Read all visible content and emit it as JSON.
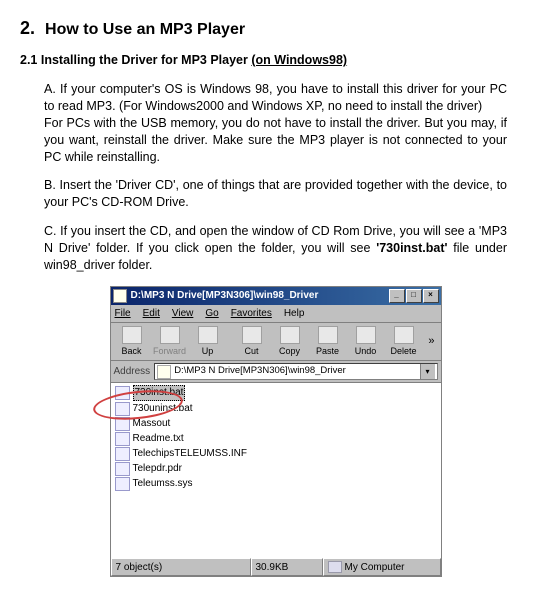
{
  "heading": {
    "num": "2.",
    "title": "How to Use an MP3 Player"
  },
  "subheading": {
    "text": "2.1 Installing the Driver for MP3 Player ",
    "paren": "(on Windows98)"
  },
  "paragraphs": {
    "a1": "A.  If your computer's OS is Windows 98, you have to install this driver for your PC to read MP3. (For Windows2000 and Windows XP, no need to install the driver)",
    "a2": "For PCs with the USB memory, you do not have to install the driver. But you may, if you want, reinstall the driver. Make sure the MP3 player is not connected to your PC while reinstalling.",
    "b": "B.  Insert the 'Driver CD', one of things that are provided together with the device, to your PC's CD-ROM Drive.",
    "c_pre": "C.  If you insert the CD, and open the window of CD Rom Drive, you will see a 'MP3 N Drive' folder. If you click open the folder, you will see ",
    "c_bold": "'730inst.bat'",
    "c_post": " file under win98_driver folder."
  },
  "window": {
    "title": "D:\\MP3 N Drive[MP3N306]\\win98_Driver",
    "btn_min": "_",
    "btn_max": "□",
    "btn_close": "×",
    "menu": [
      "File",
      "Edit",
      "View",
      "Go",
      "Favorites",
      "Help"
    ],
    "tools": {
      "back": "Back",
      "forward": "Forward",
      "up": "Up",
      "cut": "Cut",
      "copy": "Copy",
      "paste": "Paste",
      "undo": "Undo",
      "delete": "Delete"
    },
    "chev": "»",
    "address_label": "Address",
    "address_value": "D:\\MP3 N Drive[MP3N306]\\win98_Driver",
    "address_drop": "▾",
    "files": [
      "730inst.bat",
      "730uninst.bat",
      "Massout",
      "Readme.txt",
      "TelechipsTELEUMSS.INF",
      "Telepdr.pdr",
      "Teleumss.sys"
    ],
    "status": {
      "objects": "7 object(s)",
      "size": "30.9KB",
      "location": "My Computer"
    }
  }
}
